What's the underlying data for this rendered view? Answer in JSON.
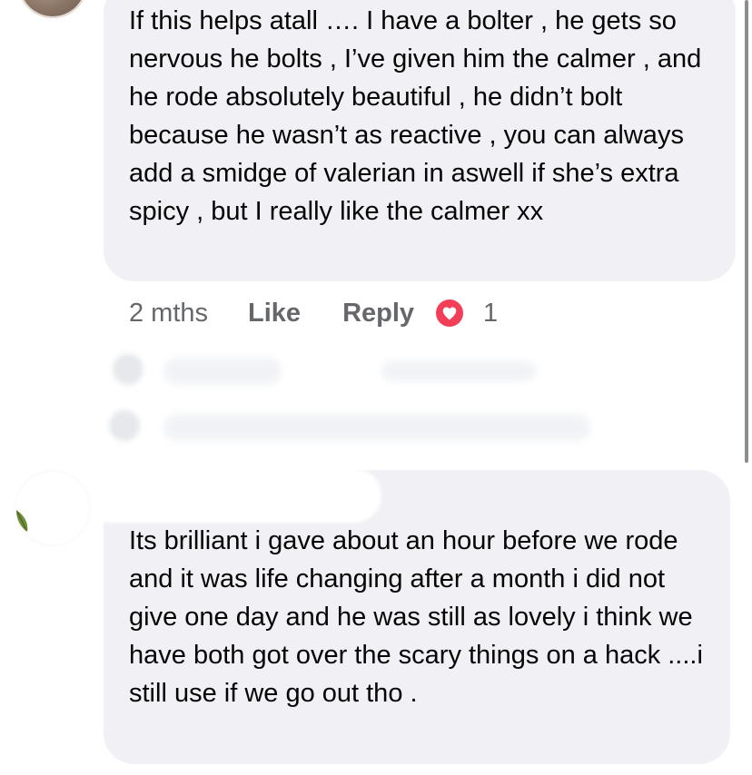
{
  "comment1": {
    "text": "If this helps atall …. I have a bolter , he gets so nervous he bolts , I’ve given him the calmer , and he rode absolutely beautiful , he didn’t bolt because he wasn’t as reactive , you can always add a smidge of valerian in aswell if she’s extra spicy , but I really like the calmer xx",
    "time": "2 mths",
    "like_label": "Like",
    "reply_label": "Reply",
    "reaction_icon": "heart-icon",
    "reaction_count": "1"
  },
  "comment2": {
    "text": "Its brilliant i gave about an hour before we rode and it was life changing after a month i did not give one day and he was still as lovely i think we have both got over the scary things on a hack ....i still use if we go out tho ."
  },
  "colors": {
    "bubble_bg": "#f0f0f5",
    "meta_text": "#65676b",
    "heart": "#f33e58"
  }
}
